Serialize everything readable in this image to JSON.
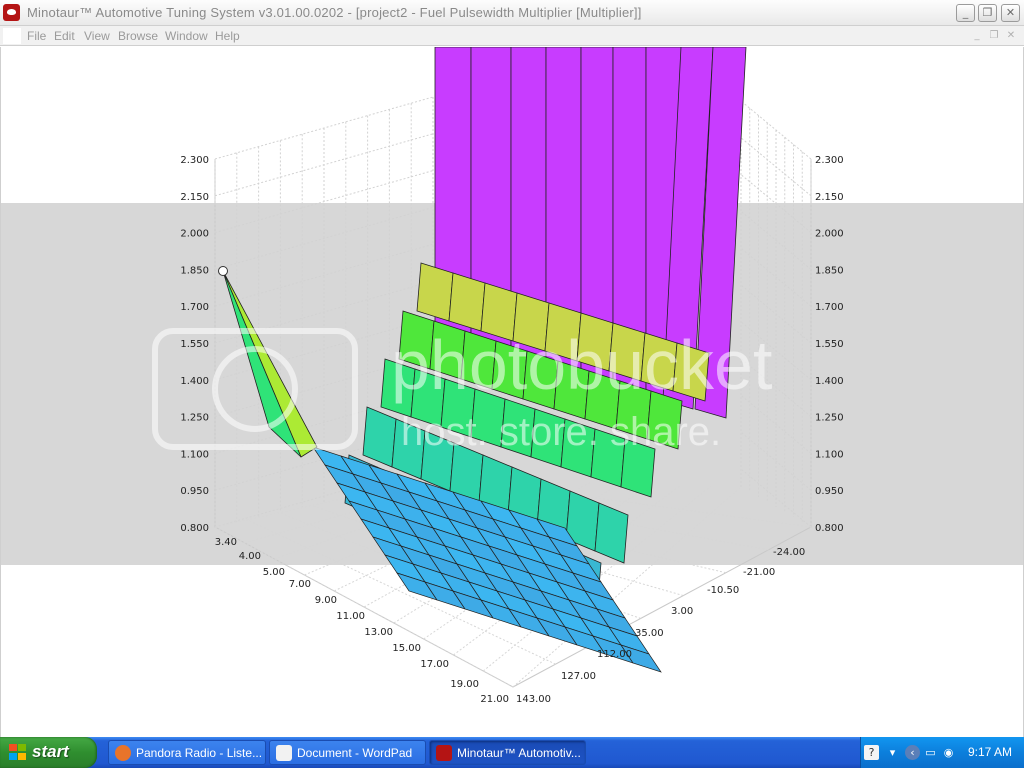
{
  "window": {
    "title": "Minotaur™ Automotive Tuning System  v3.01.00.0202 - [project2 - Fuel Pulsewidth Multiplier [Multiplier]]",
    "minimize_glyph": "_",
    "restore_glyph": "❐",
    "close_glyph": "✕"
  },
  "menu": {
    "items": [
      "File",
      "Edit",
      "View",
      "Browse",
      "Window",
      "Help"
    ],
    "mdi_minimize": "_",
    "mdi_restore": "❐",
    "mdi_close": "✕"
  },
  "watermark": {
    "line1": "photobucket",
    "line2": "host. store. share."
  },
  "chart_data": {
    "type": "surface3d",
    "z_axis_ticks_left": [
      "2.300",
      "2.150",
      "2.000",
      "1.850",
      "1.700",
      "1.550",
      "1.400",
      "1.250",
      "1.100",
      "0.950",
      "0.800"
    ],
    "z_axis_ticks_right": [
      "2.300",
      "2.150",
      "2.000",
      "1.850",
      "1.700",
      "1.550",
      "1.400",
      "1.250",
      "1.100",
      "0.950",
      "0.800"
    ],
    "x_axis_ticks": [
      "3.40",
      "4.00",
      "5.00",
      "7.00",
      "9.00",
      "11.00",
      "13.00",
      "15.00",
      "17.00",
      "19.00",
      "21.00"
    ],
    "y_axis_ticks": [
      "-24.00",
      "-21.00",
      "-10.50",
      "3.00",
      "35.00",
      "112.00",
      "127.00",
      "143.00"
    ],
    "zlim": [
      0.8,
      2.3
    ],
    "grid": true,
    "legend": "none",
    "selected_point": {
      "x": "3.40",
      "y": "-24.00",
      "z": 1.85
    }
  },
  "taskbar": {
    "start_label": "start",
    "tasks": [
      {
        "label": "Pandora Radio - Liste...",
        "icon": "firefox-icon",
        "color": "#e8742a"
      },
      {
        "label": "Document - WordPad",
        "icon": "wordpad-icon",
        "color": "#f2f2f2"
      },
      {
        "label": "Minotaur™ Automotiv...",
        "icon": "minotaur-icon",
        "color": "#b41414"
      }
    ],
    "clock": "9:17 AM"
  }
}
